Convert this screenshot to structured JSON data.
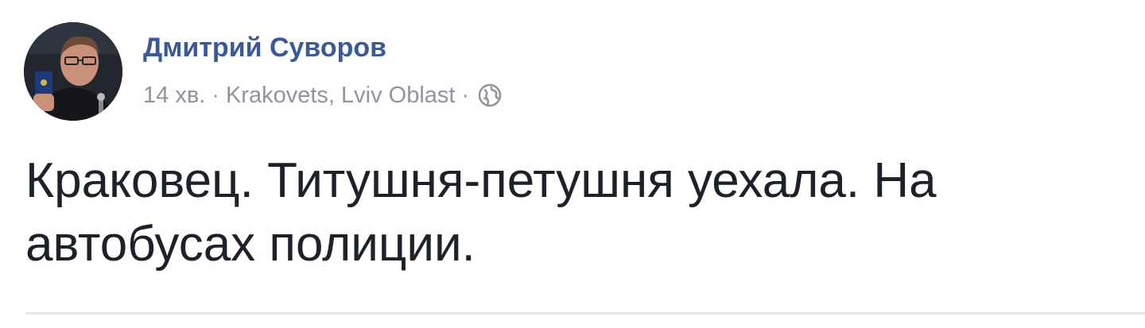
{
  "post": {
    "author_name": "Дмитрий Суворов",
    "time": "14 хв.",
    "separator": "·",
    "location": "Krakovets, Lviv Oblast",
    "audience_icon": "globe-icon",
    "text": "Краковец. Титушня-петушня уехала. На автобусах полиции."
  },
  "colors": {
    "author": "#3b5998",
    "meta": "#90949c",
    "text": "#1d2129",
    "divider": "#e4e6eb"
  }
}
